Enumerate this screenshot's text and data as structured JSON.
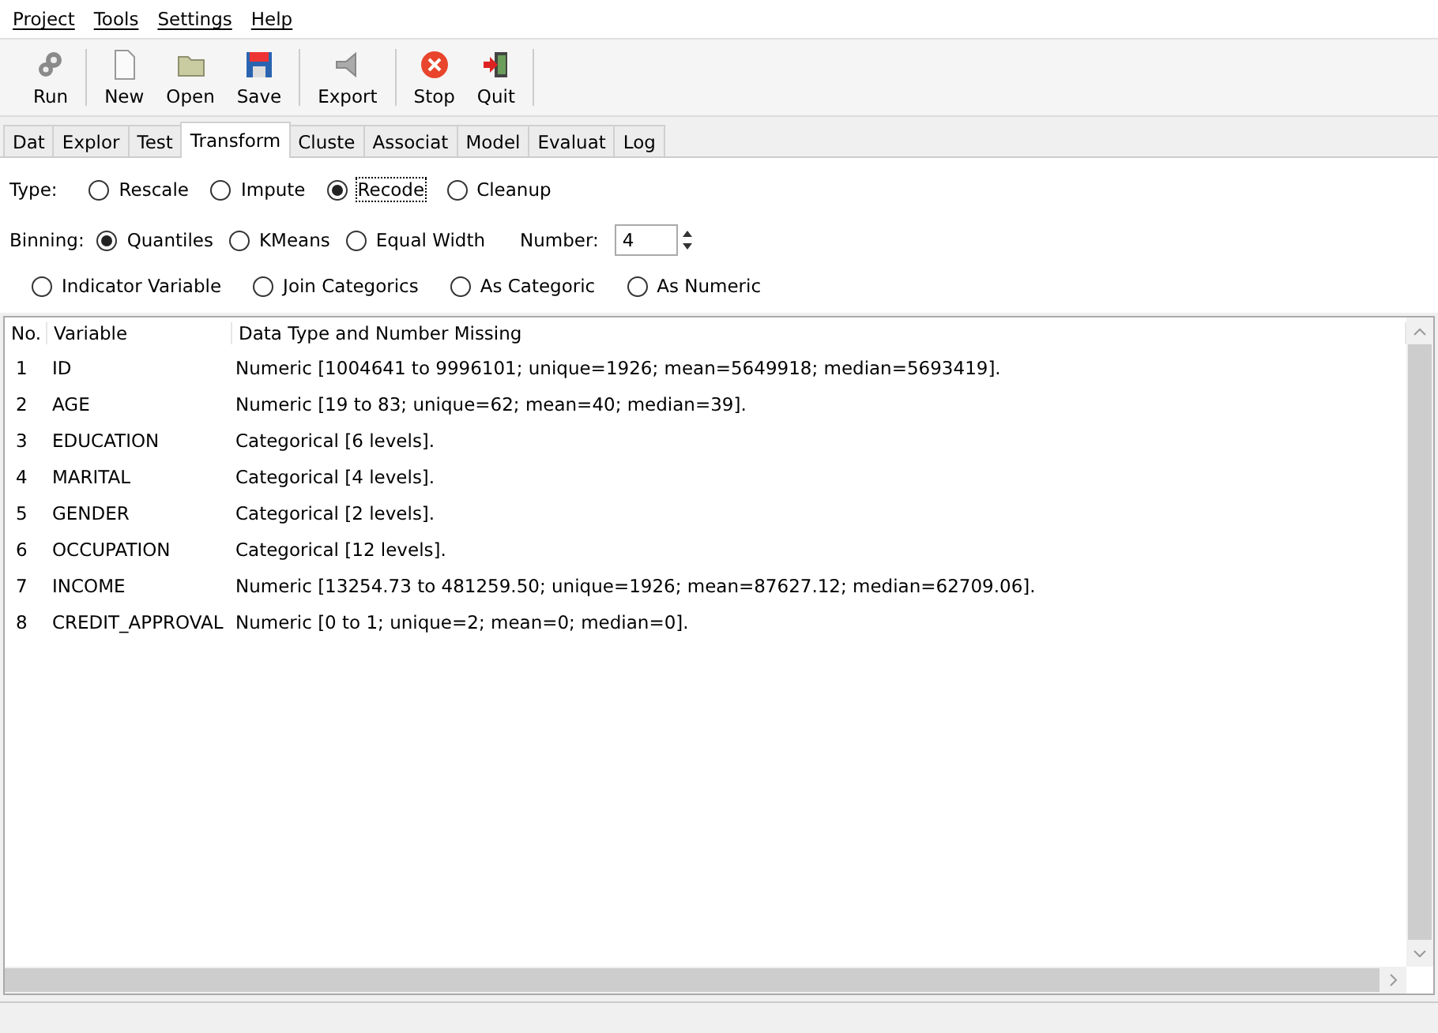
{
  "menu": [
    "Project",
    "Tools",
    "Settings",
    "Help"
  ],
  "toolbar": [
    {
      "kind": "run",
      "label": "Run"
    },
    {
      "kind": "new",
      "label": "New"
    },
    {
      "kind": "open",
      "label": "Open"
    },
    {
      "kind": "save",
      "label": "Save"
    },
    {
      "kind": "export",
      "label": "Export"
    },
    {
      "kind": "stop",
      "label": "Stop"
    },
    {
      "kind": "quit",
      "label": "Quit"
    }
  ],
  "tabs": [
    {
      "label": "Dat",
      "selected": false
    },
    {
      "label": "Explor",
      "selected": false
    },
    {
      "label": "Test",
      "selected": false
    },
    {
      "label": "Transform",
      "selected": true
    },
    {
      "label": "Cluste",
      "selected": false
    },
    {
      "label": "Associat",
      "selected": false
    },
    {
      "label": "Model",
      "selected": false
    },
    {
      "label": "Evaluat",
      "selected": false
    },
    {
      "label": "Log",
      "selected": false
    }
  ],
  "type": {
    "label": "Type:",
    "options": [
      {
        "label": "Rescale",
        "selected": false
      },
      {
        "label": "Impute",
        "selected": false
      },
      {
        "label": "Recode",
        "selected": true
      },
      {
        "label": "Cleanup",
        "selected": false
      }
    ]
  },
  "binning": {
    "label": "Binning:",
    "options": [
      {
        "label": "Quantiles",
        "selected": true
      },
      {
        "label": "KMeans",
        "selected": false
      },
      {
        "label": "Equal Width",
        "selected": false
      }
    ],
    "number_label": "Number:",
    "number_value": "4"
  },
  "recode_options": [
    {
      "label": "Indicator Variable",
      "selected": false
    },
    {
      "label": "Join Categorics",
      "selected": false
    },
    {
      "label": "As Categoric",
      "selected": false
    },
    {
      "label": "As Numeric",
      "selected": false
    }
  ],
  "table": {
    "columns": [
      "No.",
      "Variable",
      "Data Type and Number Missing"
    ],
    "rows": [
      [
        "1",
        "ID",
        "Numeric [1004641 to 9996101; unique=1926; mean=5649918; median=5693419]."
      ],
      [
        "2",
        "AGE",
        "Numeric [19 to 83; unique=62; mean=40; median=39]."
      ],
      [
        "3",
        "EDUCATION",
        "Categorical [6 levels]."
      ],
      [
        "4",
        "MARITAL",
        "Categorical [4 levels]."
      ],
      [
        "5",
        "GENDER",
        "Categorical [2 levels]."
      ],
      [
        "6",
        "OCCUPATION",
        "Categorical [12 levels]."
      ],
      [
        "7",
        "INCOME",
        "Numeric [13254.73 to 481259.50; unique=1926; mean=87627.12; median=62709.06]."
      ],
      [
        "8",
        "CREDIT_APPROVAL",
        "Numeric [0 to 1; unique=2; mean=0; median=0]."
      ]
    ]
  }
}
